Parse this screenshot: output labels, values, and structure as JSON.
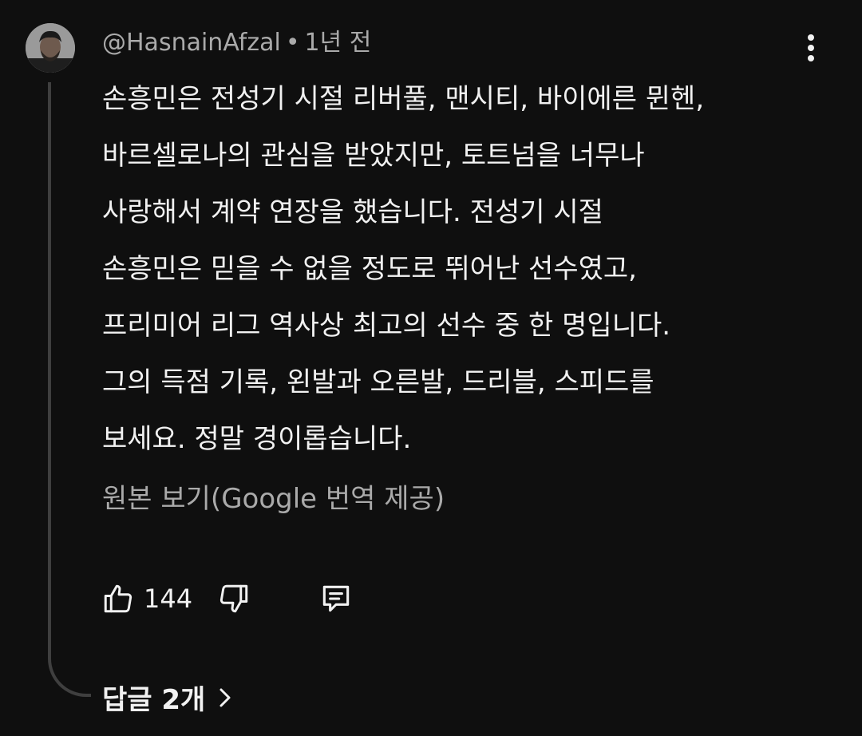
{
  "comment": {
    "author": "@HasnainAfzal",
    "separator": "•",
    "time": "1년 전",
    "lines": [
      "손흥민은 전성기 시절 리버풀, 맨시티, 바이에른 뮌헨,",
      "바르셀로나의 관심을 받았지만, 토트넘을 너무나",
      "사랑해서 계약 연장을 했습니다. 전성기 시절",
      "손흥민은 믿을 수 없을 정도로 뛰어난 선수였고,",
      "프리미어 리그 역사상 최고의 선수 중 한 명입니다.",
      "그의 득점 기록, 왼발과 오른발, 드리블, 스피드를",
      "보세요. 정말 경이롭습니다."
    ],
    "translation_link": "원본 보기(Google 번역 제공)"
  },
  "actions": {
    "like_count": "144",
    "icons": [
      "thumbs-up-icon",
      "thumbs-down-icon",
      "reply-comment-icon",
      "more-vert-icon",
      "chevron-right-icon"
    ]
  },
  "replies": {
    "label": "답글 2개"
  },
  "colors": {
    "background": "#0f0f0f",
    "text_primary": "#f1f1f1",
    "text_secondary": "#aaaaaa",
    "thread_line": "#3f3f3f"
  }
}
